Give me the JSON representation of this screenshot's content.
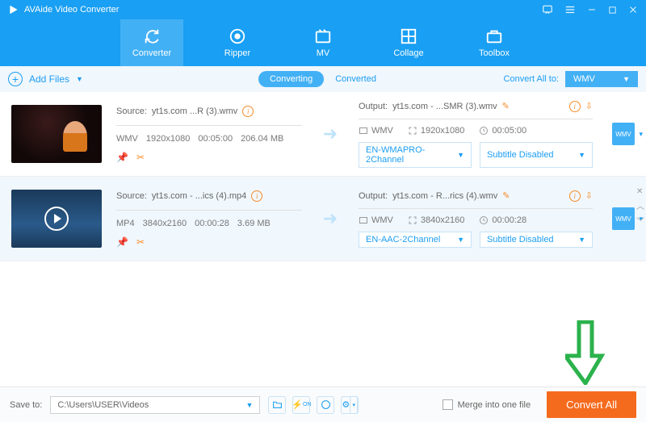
{
  "app": {
    "title": "AVAide Video Converter"
  },
  "toolbar": {
    "converter": "Converter",
    "ripper": "Ripper",
    "mv": "MV",
    "collage": "Collage",
    "toolbox": "Toolbox"
  },
  "subbar": {
    "add_files": "Add Files",
    "tab_converting": "Converting",
    "tab_converted": "Converted",
    "convert_all_to": "Convert All to:",
    "format": "WMV"
  },
  "items": [
    {
      "source_label": "Source:",
      "source_name": "yt1s.com ...R (3).wmv",
      "format": "WMV",
      "resolution": "1920x1080",
      "duration": "00:05:00",
      "size": "206.04 MB",
      "output_label": "Output:",
      "output_name": "yt1s.com - ...SMR (3).wmv",
      "out_format": "WMV",
      "out_resolution": "1920x1080",
      "out_duration": "00:05:00",
      "audio": "EN-WMAPRO-2Channel",
      "subtitle": "Subtitle Disabled"
    },
    {
      "source_label": "Source:",
      "source_name": "yt1s.com - ...ics (4).mp4",
      "format": "MP4",
      "resolution": "3840x2160",
      "duration": "00:00:28",
      "size": "3.69 MB",
      "output_label": "Output:",
      "output_name": "yt1s.com - R...rics (4).wmv",
      "out_format": "WMV",
      "out_resolution": "3840x2160",
      "out_duration": "00:00:28",
      "audio": "EN-AAC-2Channel",
      "subtitle": "Subtitle Disabled"
    }
  ],
  "footer": {
    "save_to": "Save to:",
    "path": "C:\\Users\\USER\\Videos",
    "merge": "Merge into one file",
    "convert_all": "Convert All"
  }
}
